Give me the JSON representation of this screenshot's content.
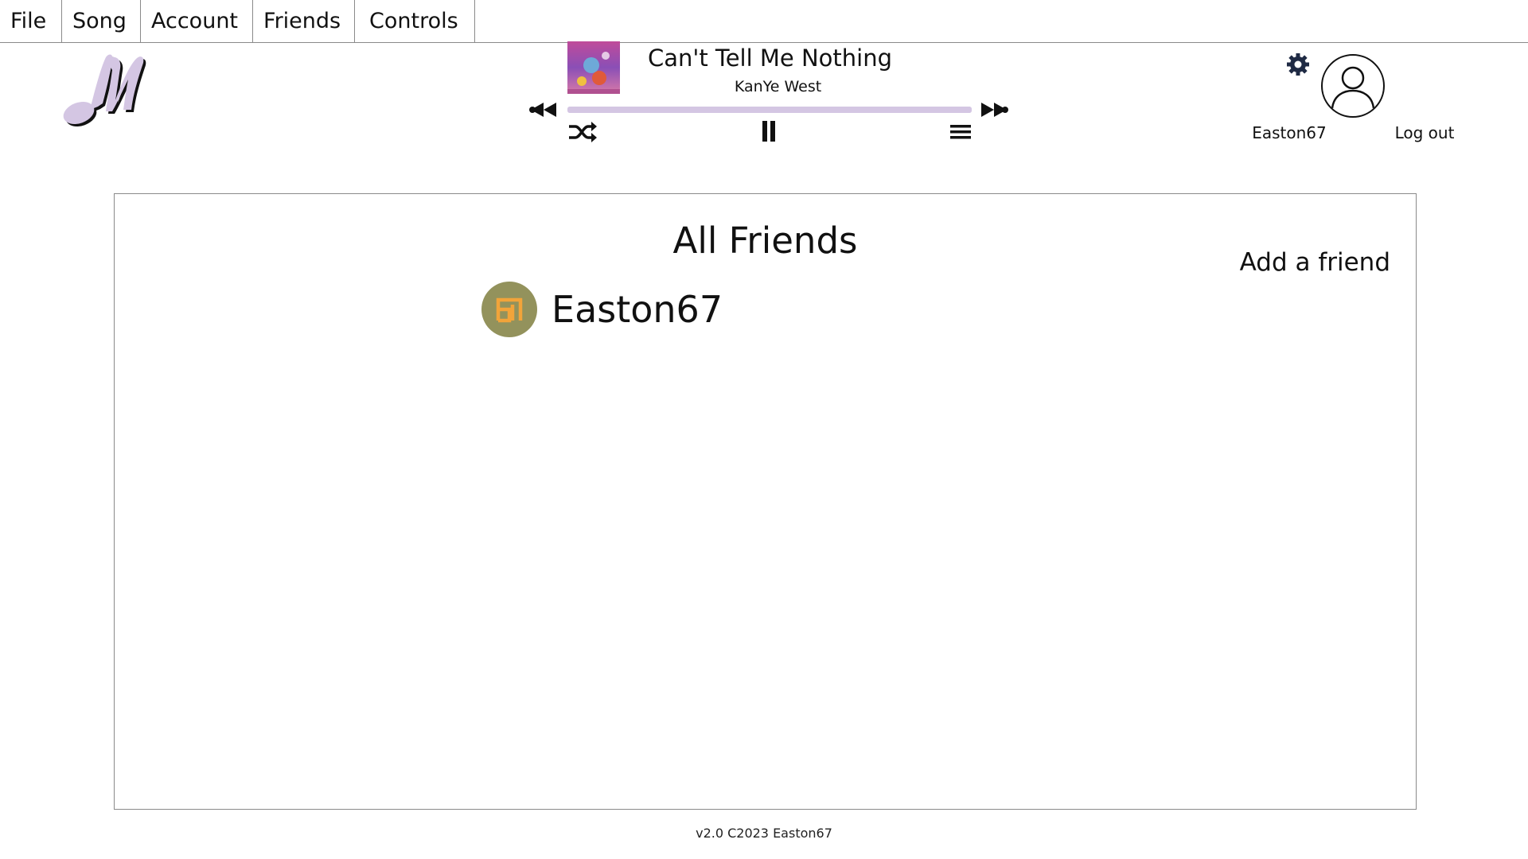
{
  "menu": {
    "items": [
      {
        "label": "File"
      },
      {
        "label": "Song"
      },
      {
        "label": "Account"
      },
      {
        "label": "Friends"
      },
      {
        "label": "Controls"
      }
    ]
  },
  "now_playing": {
    "title": "Can't Tell Me Nothing",
    "artist": "KanYe West",
    "progress": 1.0
  },
  "user": {
    "username": "Easton67",
    "logout_label": "Log out"
  },
  "friends_panel": {
    "title": "All Friends",
    "add_label": "Add a friend",
    "friends": [
      {
        "name": "Easton67"
      }
    ]
  },
  "footer": {
    "text": "v2.0 C2023 Easton67"
  },
  "colors": {
    "accent": "#d4c6e3",
    "friend_avatar_bg": "#93925c",
    "friend_avatar_glyph": "#f2a43a",
    "settings_icon": "#1f2a44"
  },
  "icons": {
    "logo": "music-note-logo",
    "prev": "rewind-icon",
    "next": "fast-forward-icon",
    "shuffle": "shuffle-icon",
    "pause": "pause-icon",
    "queue": "queue-icon",
    "settings": "gear-icon",
    "avatar": "user-avatar-icon"
  }
}
